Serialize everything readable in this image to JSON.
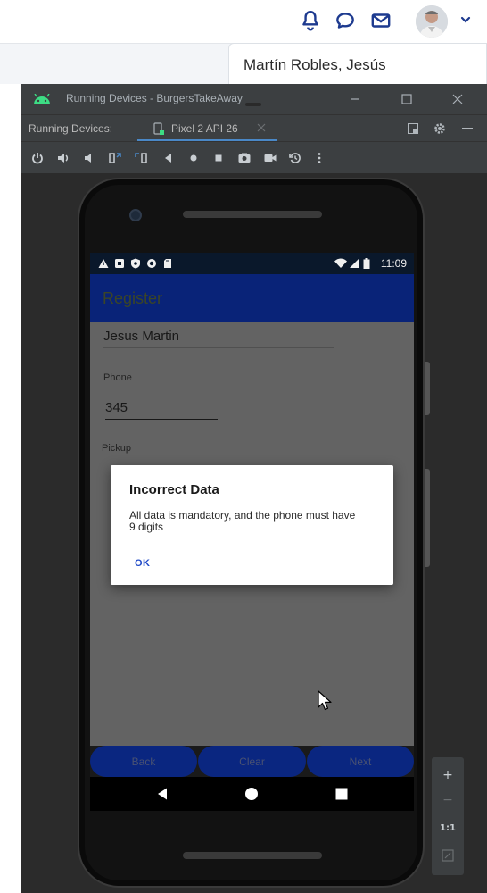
{
  "header": {
    "user_name": "Martín Robles, Jesús",
    "icons": [
      "bell-icon",
      "chat-icon",
      "mail-icon",
      "avatar",
      "chevron-down-icon"
    ],
    "accent": "#1d3a8f"
  },
  "studio": {
    "window_title": "Running Devices - BurgersTakeAway",
    "panel_label": "Running Devices:",
    "device_tab": "Pixel 2 API 26",
    "toolbar_icons": [
      "power-icon",
      "volume-up-icon",
      "volume-down-icon",
      "rotate-left-icon",
      "rotate-right-icon",
      "back-icon",
      "home-icon",
      "overview-icon",
      "screenshot-icon",
      "record-icon",
      "reset-icon",
      "more-icon"
    ],
    "zoom": {
      "in": "+",
      "out": "−",
      "actual": "1:1"
    }
  },
  "device": {
    "clock": "11:09",
    "app_title": "Register",
    "app_bar_color": "#0a2680",
    "form": {
      "name_value": "Jesus Martin",
      "phone_label": "Phone",
      "phone_value": "345",
      "pickup_label": "Pickup"
    },
    "dialog": {
      "title": "Incorrect Data",
      "message": "All data is mandatory, and the phone must have 9 digits",
      "ok_label": "OK"
    },
    "buttons": {
      "back": "Back",
      "clear": "Clear",
      "next": "Next"
    }
  }
}
